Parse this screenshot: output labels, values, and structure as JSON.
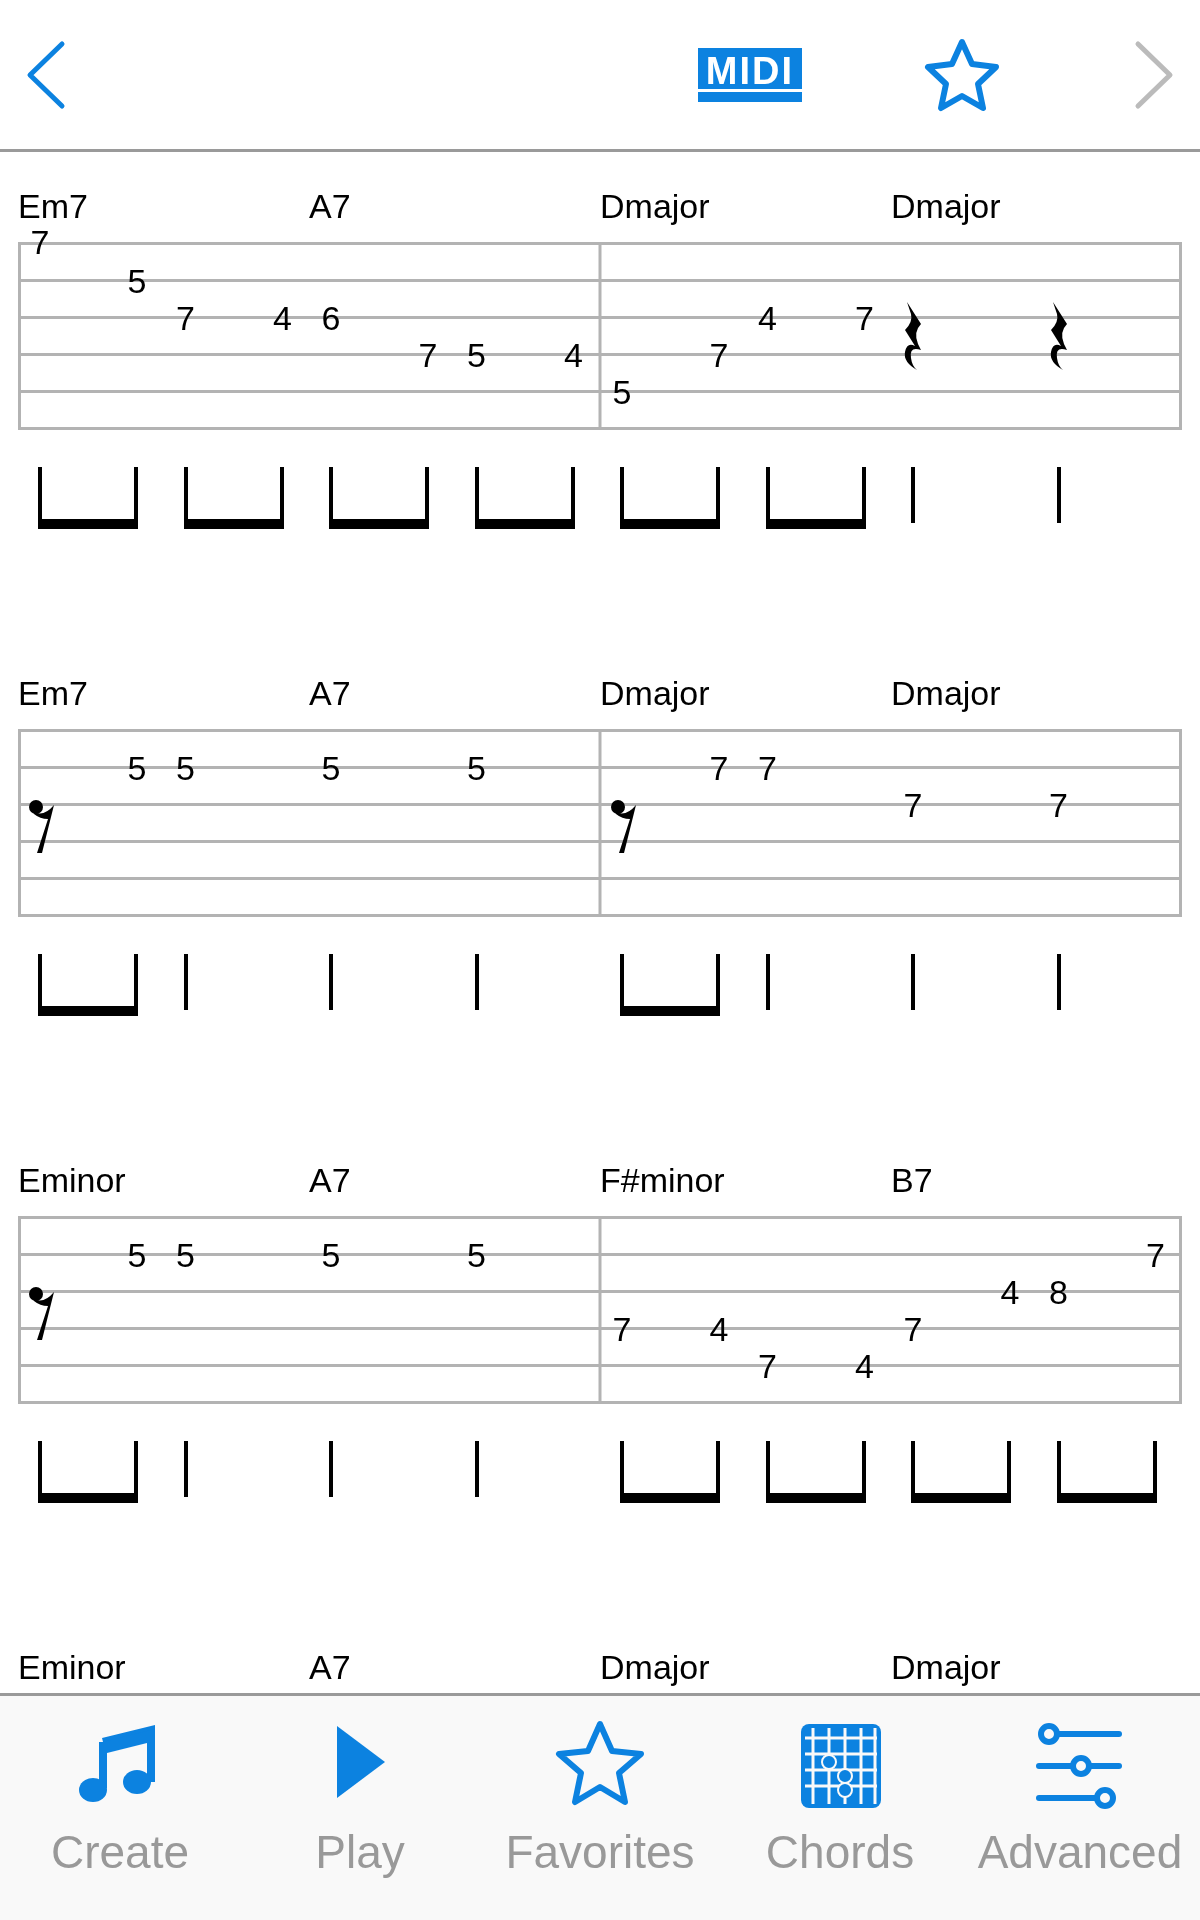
{
  "top_bar": {
    "back": {
      "disabled": false
    },
    "midi": "MIDI",
    "favorite": false,
    "forward": {
      "disabled": true
    }
  },
  "systems": [
    {
      "chords": [
        "Em7",
        "A7",
        "Dmajor",
        "Dmajor"
      ],
      "measures": [
        {
          "beats": [
            {
              "kind": "beamed"
            },
            {
              "kind": "beamed"
            },
            {
              "kind": "beamed"
            },
            {
              "kind": "beamed"
            }
          ],
          "columns": [
            {
              "kind": "high_e",
              "fret": "7"
            },
            {
              "kind": "blank"
            },
            {
              "kind": "b",
              "fret": "5"
            },
            {
              "kind": "g",
              "fret": "7"
            },
            {
              "kind": "blank"
            },
            {
              "kind": "g",
              "fret": "4"
            },
            {
              "kind": "g",
              "fret": "6"
            },
            {
              "kind": "blank"
            },
            {
              "kind": "d",
              "fret": "7"
            },
            {
              "kind": "d",
              "fret": "5"
            },
            {
              "kind": "blank"
            },
            {
              "kind": "d",
              "fret": "4"
            }
          ]
        },
        {
          "beats": [
            {
              "kind": "beamed"
            },
            {
              "kind": "beamed"
            },
            {
              "kind": "single"
            },
            {
              "kind": "single"
            }
          ],
          "columns": [
            {
              "kind": "a",
              "fret": "5"
            },
            {
              "kind": "blank"
            },
            {
              "kind": "d",
              "fret": "7"
            },
            {
              "kind": "g",
              "fret": "4"
            },
            {
              "kind": "blank"
            },
            {
              "kind": "g",
              "fret": "7"
            },
            {
              "kind": "quarter_rest"
            },
            {
              "kind": "blank"
            },
            {
              "kind": "blank"
            },
            {
              "kind": "quarter_rest"
            }
          ]
        }
      ]
    },
    {
      "chords": [
        "Em7",
        "A7",
        "Dmajor",
        "Dmajor"
      ],
      "measures": [
        {
          "beats": [
            {
              "kind": "beamed"
            },
            {
              "kind": "single"
            },
            {
              "kind": "single"
            },
            {
              "kind": "single"
            }
          ],
          "columns": [
            {
              "kind": "eighth_rest"
            },
            {
              "kind": "blank"
            },
            {
              "kind": "b",
              "fret": "5"
            },
            {
              "kind": "b",
              "fret": "5"
            },
            {
              "kind": "blank"
            },
            {
              "kind": "blank"
            },
            {
              "kind": "b",
              "fret": "5"
            },
            {
              "kind": "blank"
            },
            {
              "kind": "blank"
            },
            {
              "kind": "b",
              "fret": "5"
            }
          ]
        },
        {
          "beats": [
            {
              "kind": "beamed"
            },
            {
              "kind": "single"
            },
            {
              "kind": "single"
            },
            {
              "kind": "single"
            }
          ],
          "columns": [
            {
              "kind": "eighth_rest"
            },
            {
              "kind": "blank"
            },
            {
              "kind": "b",
              "fret": "7"
            },
            {
              "kind": "b",
              "fret": "7"
            },
            {
              "kind": "blank"
            },
            {
              "kind": "blank"
            },
            {
              "kind": "g",
              "fret": "7"
            },
            {
              "kind": "blank"
            },
            {
              "kind": "blank"
            },
            {
              "kind": "g",
              "fret": "7"
            }
          ]
        }
      ]
    },
    {
      "chords": [
        "Eminor",
        "A7",
        "F#minor",
        "B7"
      ],
      "measures": [
        {
          "beats": [
            {
              "kind": "beamed"
            },
            {
              "kind": "single"
            },
            {
              "kind": "single"
            },
            {
              "kind": "single"
            }
          ],
          "columns": [
            {
              "kind": "eighth_rest"
            },
            {
              "kind": "blank"
            },
            {
              "kind": "b",
              "fret": "5"
            },
            {
              "kind": "b",
              "fret": "5"
            },
            {
              "kind": "blank"
            },
            {
              "kind": "blank"
            },
            {
              "kind": "b",
              "fret": "5"
            },
            {
              "kind": "blank"
            },
            {
              "kind": "blank"
            },
            {
              "kind": "b",
              "fret": "5"
            }
          ]
        },
        {
          "beats": [
            {
              "kind": "beamed"
            },
            {
              "kind": "beamed"
            },
            {
              "kind": "beamed"
            },
            {
              "kind": "beamed"
            }
          ],
          "columns": [
            {
              "kind": "d",
              "fret": "7"
            },
            {
              "kind": "blank"
            },
            {
              "kind": "d",
              "fret": "4"
            },
            {
              "kind": "a",
              "fret": "7"
            },
            {
              "kind": "blank"
            },
            {
              "kind": "a",
              "fret": "4"
            },
            {
              "kind": "d",
              "fret": "7"
            },
            {
              "kind": "blank"
            },
            {
              "kind": "g",
              "fret": "4"
            },
            {
              "kind": "g",
              "fret": "8"
            },
            {
              "kind": "blank"
            },
            {
              "kind": "b",
              "fret": "7"
            }
          ]
        }
      ]
    },
    {
      "chords": [
        "Eminor",
        "A7",
        "Dmajor",
        "Dmajor"
      ]
    }
  ],
  "tab_bar": [
    {
      "kind": "create",
      "label": "Create"
    },
    {
      "kind": "play",
      "label": "Play"
    },
    {
      "kind": "favorites",
      "label": "Favorites"
    },
    {
      "kind": "chords",
      "label": "Chords"
    },
    {
      "kind": "advanced",
      "label": "Advanced"
    }
  ]
}
